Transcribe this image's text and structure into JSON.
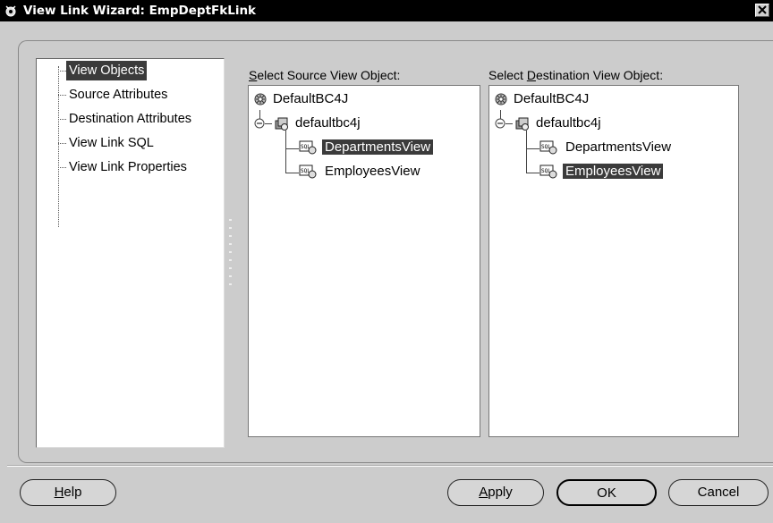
{
  "window": {
    "title": "View Link Wizard: EmpDeptFkLink"
  },
  "nav": {
    "items": [
      {
        "label": "View Objects",
        "selected": true
      },
      {
        "label": "Source Attributes",
        "selected": false
      },
      {
        "label": "Destination Attributes",
        "selected": false
      },
      {
        "label": "View Link SQL",
        "selected": false
      },
      {
        "label": "View Link Properties",
        "selected": false
      }
    ]
  },
  "source": {
    "label_prefix": "",
    "label_mnemonic": "S",
    "label_rest": "elect Source View Object:",
    "root": "DefaultBC4J",
    "package": "defaultbc4j",
    "views": [
      {
        "label": "DepartmentsView",
        "selected": true
      },
      {
        "label": "EmployeesView",
        "selected": false
      }
    ]
  },
  "destination": {
    "label_prefix": "Select ",
    "label_mnemonic": "D",
    "label_rest": "estination View Object:",
    "root": "DefaultBC4J",
    "package": "defaultbc4j",
    "views": [
      {
        "label": "DepartmentsView",
        "selected": false
      },
      {
        "label": "EmployeesView",
        "selected": true
      }
    ]
  },
  "buttons": {
    "help": {
      "mnemonic": "H",
      "rest": "elp"
    },
    "apply": {
      "mnemonic": "A",
      "rest": "pply"
    },
    "ok": "OK",
    "cancel": "Cancel"
  },
  "colors": {
    "titlebar": "#000000",
    "selection": "#3b3b3b",
    "background": "#cccccc"
  }
}
